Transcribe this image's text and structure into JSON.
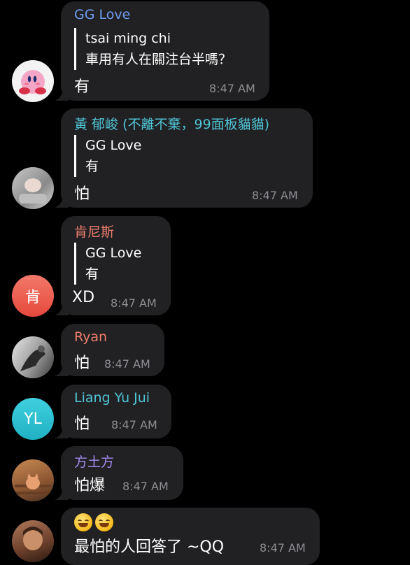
{
  "theme": {
    "bubble_color": "#212123",
    "time_color": "#8e8e93"
  },
  "messages": [
    {
      "sender": "GG Love",
      "sender_color": "#6f9cf0",
      "reply_author": "tsai ming chi",
      "reply_text": "車用有人在關注台半嗎？",
      "text": "有",
      "time": "8:47 AM",
      "avatar": "kirby-avatar"
    },
    {
      "sender": "黃 郁峻 (不離不棄，99面板貓貓)",
      "sender_color": "#4fc5d6",
      "reply_author": "GG Love",
      "reply_text": "有",
      "text": "怕",
      "time": "8:47 AM",
      "avatar": "photo-avatar"
    },
    {
      "sender": "肯尼斯",
      "sender_color": "#ef7d6e",
      "reply_author": "GG Love",
      "reply_text": "有",
      "text": "XD",
      "time": "8:47 AM",
      "avatar_initials": "肯",
      "avatar_color": "#ef5d4e"
    },
    {
      "sender": "Ryan",
      "sender_color": "#ef7d6e",
      "text": "怕",
      "time": "8:47 AM",
      "avatar": "photo-avatar"
    },
    {
      "sender": "Liang Yu Jui",
      "sender_color": "#4fc5d6",
      "text": "怕",
      "time": "8:47 AM",
      "avatar_initials": "YL",
      "avatar_color": "#26b8c9"
    },
    {
      "sender": "方土方",
      "sender_color": "#a58bf0",
      "text": "怕爆",
      "time": "8:47 AM",
      "avatar": "cat-photo-avatar"
    },
    {
      "emojis": [
        "grinning-face-emoji",
        "grinning-face-emoji"
      ],
      "text": "最怕的人回答了 ~QQ",
      "time": "8:47 AM",
      "avatar": "photo-avatar"
    }
  ]
}
